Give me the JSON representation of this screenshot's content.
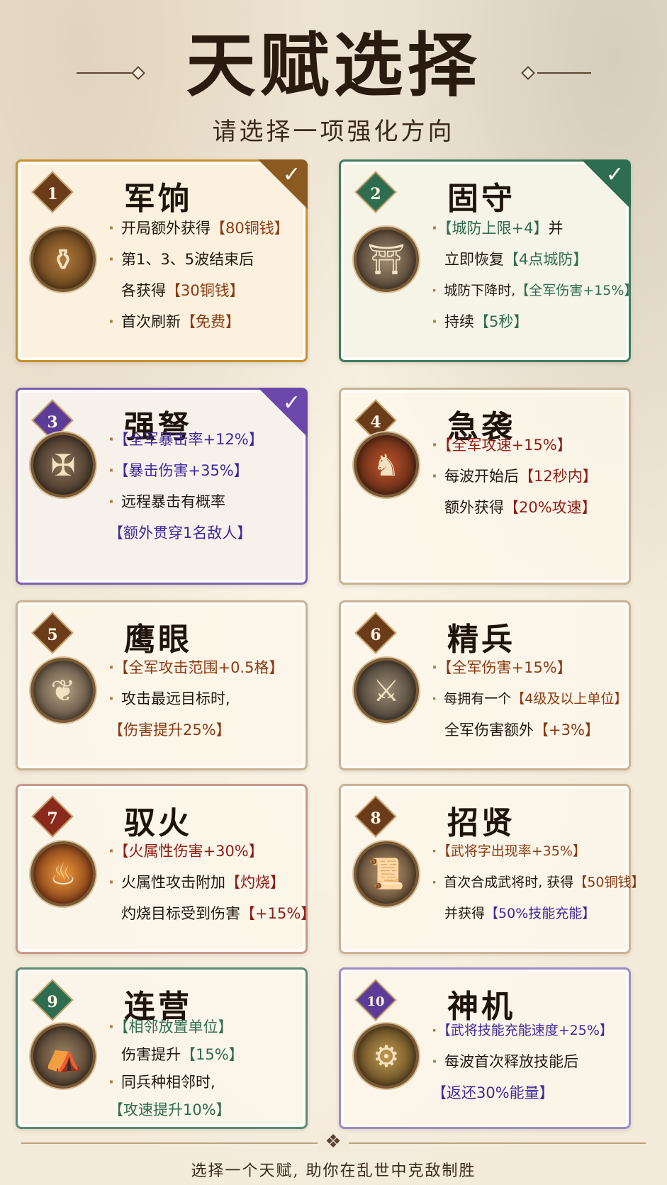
{
  "header": {
    "title": "天赋选择",
    "subtitle": "请选择一项强化方向"
  },
  "cards": [
    {
      "number": "1",
      "name": "军饷",
      "selected": true,
      "icon": "money-bag-icon",
      "lines": [
        {
          "pre": "开局额外获得",
          "hl": "【80铜钱】",
          "post": ""
        },
        {
          "pre": "第1、3、5波结束后",
          "hl": "",
          "post": ""
        },
        {
          "pre": "各获得",
          "hl": "【30铜钱】",
          "post": ""
        },
        {
          "pre": "首次刷新",
          "hl": "【免费】",
          "post": ""
        }
      ]
    },
    {
      "number": "2",
      "name": "固守",
      "selected": true,
      "icon": "fortress-icon",
      "lines": [
        {
          "pre": "",
          "hl": "【城防上限+4】",
          "post": "并"
        },
        {
          "pre": "立即恢复",
          "hl": "【4点城防】",
          "post": ""
        },
        {
          "pre": "城防下降时,",
          "hl": "【全军伤害+15%】",
          "post": ""
        },
        {
          "pre": "持续",
          "hl": "【5秒】",
          "post": ""
        }
      ]
    },
    {
      "number": "3",
      "name": "强弩",
      "selected": true,
      "icon": "crossbow-icon",
      "lines": [
        {
          "pre": "",
          "hl": "【全军暴击率+12%】",
          "post": ""
        },
        {
          "pre": "",
          "hl": "【暴击伤害+35%】",
          "post": ""
        },
        {
          "pre": "远程暴击有概率",
          "hl": "",
          "post": ""
        },
        {
          "pre": "",
          "hl": "【额外贯穿1名敌人】",
          "post": ""
        }
      ]
    },
    {
      "number": "4",
      "name": "急袭",
      "selected": false,
      "icon": "horse-rider-icon",
      "lines": [
        {
          "pre": "",
          "hl": "【全军攻速+15%】",
          "post": ""
        },
        {
          "pre": "每波开始后",
          "hl": "【12秒内】",
          "post": ""
        },
        {
          "pre": "额外获得",
          "hl": "【20%攻速】",
          "post": ""
        }
      ]
    },
    {
      "number": "5",
      "name": "鹰眼",
      "selected": false,
      "icon": "eagle-icon",
      "lines": [
        {
          "pre": "",
          "hl": "【全军攻击范围+0.5格】",
          "post": ""
        },
        {
          "pre": "攻击最远目标时,",
          "hl": "",
          "post": ""
        },
        {
          "pre": "",
          "hl": "【伤害提升25%】",
          "post": ""
        }
      ]
    },
    {
      "number": "6",
      "name": "精兵",
      "selected": false,
      "icon": "soldiers-icon",
      "lines": [
        {
          "pre": "",
          "hl": "【全军伤害+15%】",
          "post": ""
        },
        {
          "pre": "每拥有一个",
          "hl": "【4级及以上单位】",
          "post": ""
        },
        {
          "pre": "全军伤害额外",
          "hl": "【+3%】",
          "post": ""
        }
      ]
    },
    {
      "number": "7",
      "name": "驭火",
      "selected": false,
      "icon": "fire-icon",
      "lines": [
        {
          "pre": "",
          "hl": "【火属性伤害+30%】",
          "post": ""
        },
        {
          "pre": "火属性攻击附加",
          "hl": "【灼烧】",
          "post": ""
        },
        {
          "pre": "灼烧目标受到伤害",
          "hl": "【+15%】",
          "post": ""
        }
      ]
    },
    {
      "number": "8",
      "name": "招贤",
      "selected": false,
      "icon": "scroll-general-icon",
      "lines": [
        {
          "pre": "",
          "hl": "【武将字出现率+35%】",
          "post": ""
        },
        {
          "pre": "首次合成武将时, 获得",
          "hl": "【50铜钱】",
          "post": ""
        },
        {
          "pre": "并获得",
          "hl": "【50%技能充能】",
          "post": ""
        }
      ]
    },
    {
      "number": "9",
      "name": "连营",
      "selected": false,
      "icon": "camp-icon",
      "lines": [
        {
          "pre": "",
          "hl": "【相邻放置单位】",
          "post": ""
        },
        {
          "pre": "伤害提升",
          "hl": "【15%】",
          "post": ""
        },
        {
          "pre": "同兵种相邻时,",
          "hl": "",
          "post": ""
        },
        {
          "pre": "",
          "hl": "【攻速提升10%】",
          "post": ""
        }
      ]
    },
    {
      "number": "10",
      "name": "神机",
      "selected": false,
      "icon": "gear-mechanism-icon",
      "lines": [
        {
          "pre": "",
          "hl": "【武将技能充能速度+25%】",
          "post": ""
        },
        {
          "pre": "每波首次释放技能后",
          "hl": "",
          "post": ""
        },
        {
          "pre": "",
          "hl": "【返还30%能量】",
          "post": ""
        }
      ]
    }
  ],
  "footer": {
    "text": "选择一个天赋, 助你在乱世中克敌制胜"
  }
}
